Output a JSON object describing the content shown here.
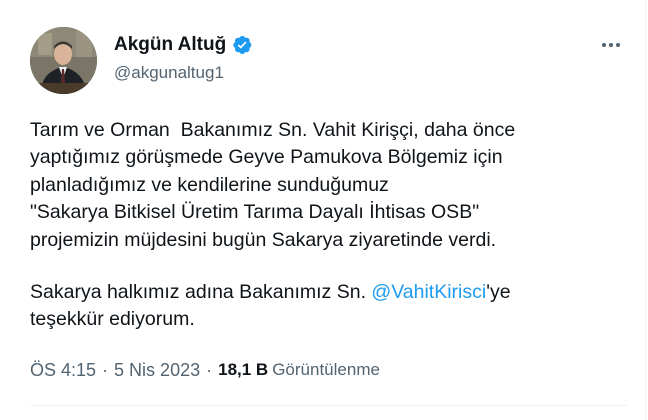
{
  "author": {
    "display_name": "Akgün Altuğ",
    "handle": "@akgunaltug1",
    "verified_icon": "verified-badge-icon",
    "verified_color": "#1d9bf0"
  },
  "more_icon": "more-options-icon",
  "tweet": {
    "line1": "Tarım ve Orman  Bakanımız Sn. Vahit Kirişçi, daha önce",
    "line2": "yaptığımız görüşmede Geyve Pamukova Bölgemiz için",
    "line3": "planladığımız ve kendilerine sunduğumuz",
    "line4": "\"Sakarya Bitkisel Üretim Tarıma Dayalı İhtisas OSB\"",
    "line5": "projemizin müjdesini bugün Sakarya ziyaretinde verdi.",
    "line6_prefix": "Sakarya halkımız adına Bakanımız Sn. ",
    "line6_mention": "@VahitKirisci",
    "line6_suffix": "'ye",
    "line7": "teşekkür ediyorum."
  },
  "meta": {
    "time": "ÖS 4:15",
    "separator": "·",
    "date": "5 Nis 2023",
    "views_count": "18,1 B",
    "views_label": "Görüntülenme"
  },
  "colors": {
    "text": "#0f1419",
    "secondary": "#536471",
    "link": "#1d9bf0"
  }
}
